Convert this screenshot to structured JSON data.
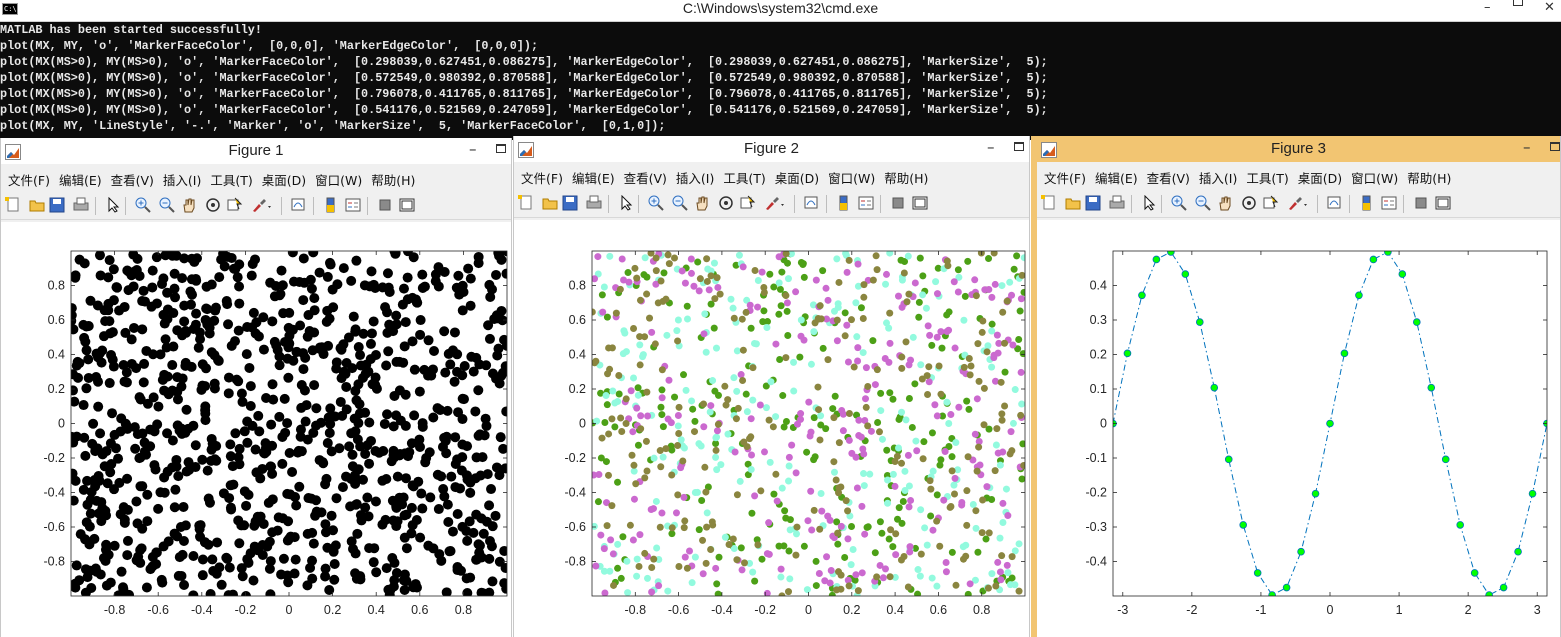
{
  "cmd": {
    "title": "C:\\Windows\\system32\\cmd.exe",
    "icon": "cmd-icon",
    "icon_text": "C:\\",
    "lines": [
      "MATLAB has been started successfully!",
      "plot(MX, MY, 'o', 'MarkerFaceColor',  [0,0,0], 'MarkerEdgeColor',  [0,0,0]);",
      "plot(MX(MS>0), MY(MS>0), 'o', 'MarkerFaceColor',  [0.298039,0.627451,0.086275], 'MarkerEdgeColor',  [0.298039,0.627451,0.086275], 'MarkerSize',  5);",
      "plot(MX(MS>0), MY(MS>0), 'o', 'MarkerFaceColor',  [0.572549,0.980392,0.870588], 'MarkerEdgeColor',  [0.572549,0.980392,0.870588], 'MarkerSize',  5);",
      "plot(MX(MS>0), MY(MS>0), 'o', 'MarkerFaceColor',  [0.796078,0.411765,0.811765], 'MarkerEdgeColor',  [0.796078,0.411765,0.811765], 'MarkerSize',  5);",
      "plot(MX(MS>0), MY(MS>0), 'o', 'MarkerFaceColor',  [0.541176,0.521569,0.247059], 'MarkerEdgeColor',  [0.541176,0.521569,0.247059], 'MarkerSize',  5);",
      "plot(MX, MY, 'LineStyle', '-.', 'Marker', 'o', 'MarkerSize',  5, 'MarkerFaceColor',  [0,1,0]);"
    ]
  },
  "menus": [
    "文件(F)",
    "编辑(E)",
    "查看(V)",
    "插入(I)",
    "工具(T)",
    "桌面(D)",
    "窗口(W)",
    "帮助(H)"
  ],
  "toolbar_icons": [
    "new-figure-icon",
    "open-file-icon",
    "save-icon",
    "print-icon",
    "pointer-icon",
    "zoom-in-icon",
    "zoom-out-icon",
    "pan-hand-icon",
    "rotate-3d-icon",
    "data-cursor-icon",
    "brush-icon",
    "link-plot-icon",
    "colorbar-icon",
    "legend-icon",
    "hide-plot-tools-icon",
    "show-plot-tools-icon"
  ],
  "figures": [
    {
      "title": "Figure 1",
      "active": false
    },
    {
      "title": "Figure 2",
      "active": false
    },
    {
      "title": "Figure 3",
      "active": true
    }
  ],
  "chart_data": [
    {
      "type": "scatter",
      "title": "",
      "xlabel": "",
      "ylabel": "",
      "xlim": [
        -1,
        1
      ],
      "ylim": [
        -1,
        1
      ],
      "xticks": [
        "-0.8",
        "-0.6",
        "-0.4",
        "-0.2",
        "0",
        "0.2",
        "0.4",
        "0.6",
        "0.8"
      ],
      "yticks": [
        "0.8",
        "0.6",
        "0.4",
        "0.2",
        "0",
        "-0.2",
        "-0.4",
        "-0.6",
        "-0.8"
      ],
      "series": [
        {
          "color": "#000000",
          "count": 1000,
          "distribution": "uniform random in [-1,1]x[-1,1]"
        }
      ]
    },
    {
      "type": "scatter",
      "title": "",
      "xlabel": "",
      "ylabel": "",
      "xlim": [
        -1,
        1
      ],
      "ylim": [
        -1,
        1
      ],
      "xticks": [
        "-0.8",
        "-0.6",
        "-0.4",
        "-0.2",
        "0",
        "0.2",
        "0.4",
        "0.6",
        "0.8"
      ],
      "yticks": [
        "0.8",
        "0.6",
        "0.4",
        "0.2",
        "0",
        "-0.2",
        "-0.4",
        "-0.6",
        "-0.8"
      ],
      "series": [
        {
          "color": "#4ca016",
          "count": 250,
          "distribution": "uniform random in [-1,1]x[-1,1]"
        },
        {
          "color": "#92fade",
          "count": 250,
          "distribution": "uniform random in [-1,1]x[-1,1]"
        },
        {
          "color": "#cb69cf",
          "count": 250,
          "distribution": "uniform random in [-1,1]x[-1,1]"
        },
        {
          "color": "#8a853f",
          "count": 250,
          "distribution": "uniform random in [-1,1]x[-1,1]"
        }
      ]
    },
    {
      "type": "line",
      "title": "",
      "xlabel": "",
      "ylabel": "",
      "xlim": [
        -3.1416,
        3.1416
      ],
      "ylim": [
        -0.5,
        0.5
      ],
      "xticks": [
        "-3",
        "-2",
        "-1",
        "0",
        "1",
        "2",
        "3"
      ],
      "yticks": [
        "0.4",
        "0.3",
        "0.2",
        "0.1",
        "0",
        "-0.1",
        "-0.2",
        "-0.3",
        "-0.4"
      ],
      "line_style": "-.",
      "line_color": "#0072bd",
      "marker": "o",
      "marker_face_color": "#00ff00",
      "x": [
        -3.1416,
        -3.0307,
        -2.9199,
        -2.809,
        -2.6982,
        -2.5873,
        -2.4765,
        -2.3656,
        -2.2548,
        -2.1439,
        -2.0331,
        -1.9222,
        -1.8114,
        -1.7005,
        -1.5897,
        -1.4788,
        -1.368,
        -1.2571,
        -1.1463,
        -1.0354,
        -0.9246,
        -0.8137,
        -0.7029,
        -0.592,
        -0.4812,
        -0.3703,
        -0.2595,
        -0.1486,
        -0.0378,
        0.0731,
        0.1839,
        0.2948,
        0.4056,
        0.5165,
        0.6273,
        0.7382,
        0.849,
        0.9599,
        1.0707,
        1.1816,
        1.2924,
        1.4033,
        1.5141,
        1.625,
        1.7358,
        1.8467,
        1.9575,
        2.0684,
        2.1792,
        2.2901,
        2.4009,
        2.5118,
        2.6226,
        2.7335,
        2.8443,
        2.9552,
        3.066
      ],
      "y_expr": "0.5*sin(2x)",
      "x_markers": [
        -3.1416,
        -2.9322,
        -2.7227,
        -2.5133,
        -2.3038,
        -2.0944,
        -1.885,
        -1.6755,
        -1.4661,
        -1.2566,
        -1.0472,
        -0.8378,
        -0.6283,
        -0.4189,
        -0.2094,
        0,
        0.2094,
        0.4189,
        0.6283,
        0.8378,
        1.0472,
        1.2566,
        1.4661,
        1.6755,
        1.885,
        2.0944,
        2.3038,
        2.5133,
        2.7227,
        2.9322,
        3.1416
      ]
    }
  ]
}
